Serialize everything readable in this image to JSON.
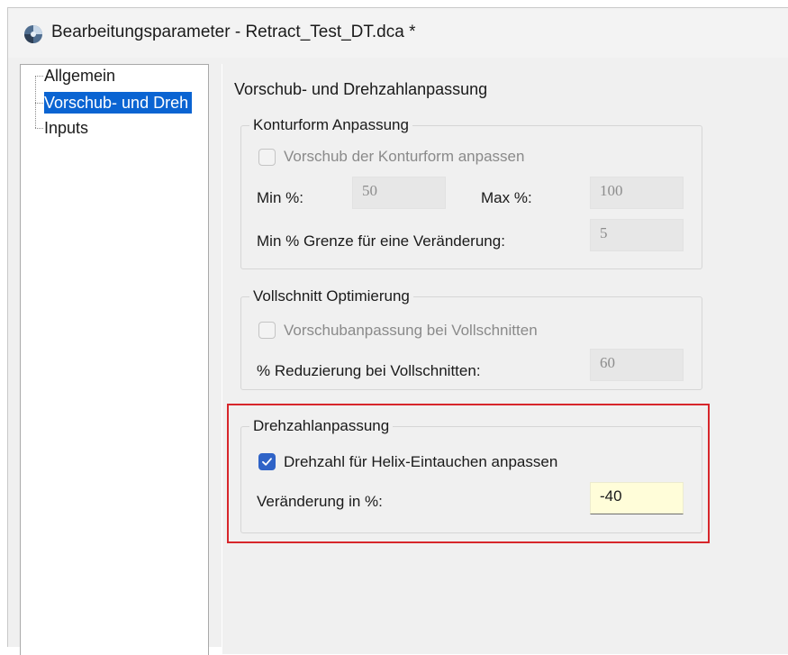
{
  "window": {
    "title": "Bearbeitungsparameter - Retract_Test_DT.dca *"
  },
  "tree": {
    "items": [
      {
        "label": "Allgemein"
      },
      {
        "label": "Vorschub- und Dreh"
      },
      {
        "label": "Inputs"
      }
    ]
  },
  "page": {
    "title": "Vorschub- und Drehzahlanpassung"
  },
  "kontur": {
    "label": "Konturform Anpassung",
    "checkbox_label": "Vorschub der Konturform anpassen",
    "checked": false,
    "min_label": "Min %:",
    "min_value": "50",
    "max_label": "Max %:",
    "max_value": "100",
    "limit_label": "Min % Grenze für eine Veränderung:",
    "limit_value": "5"
  },
  "vollschnitt": {
    "label": "Vollschnitt Optimierung",
    "checkbox_label": "Vorschubanpassung bei Vollschnitten",
    "checked": false,
    "reduction_label": "% Reduzierung bei Vollschnitten:",
    "reduction_value": "60"
  },
  "drehzahl": {
    "label": "Drehzahlanpassung",
    "checkbox_label": "Drehzahl für Helix-Eintauchen anpassen",
    "checked": true,
    "change_label": "Veränderung in %:",
    "change_value": "-40"
  },
  "colors": {
    "selection": "#0a64d2",
    "checkbox_on": "#2f63c7",
    "highlight": "#d7262b",
    "active_field": "#fffdd9"
  }
}
